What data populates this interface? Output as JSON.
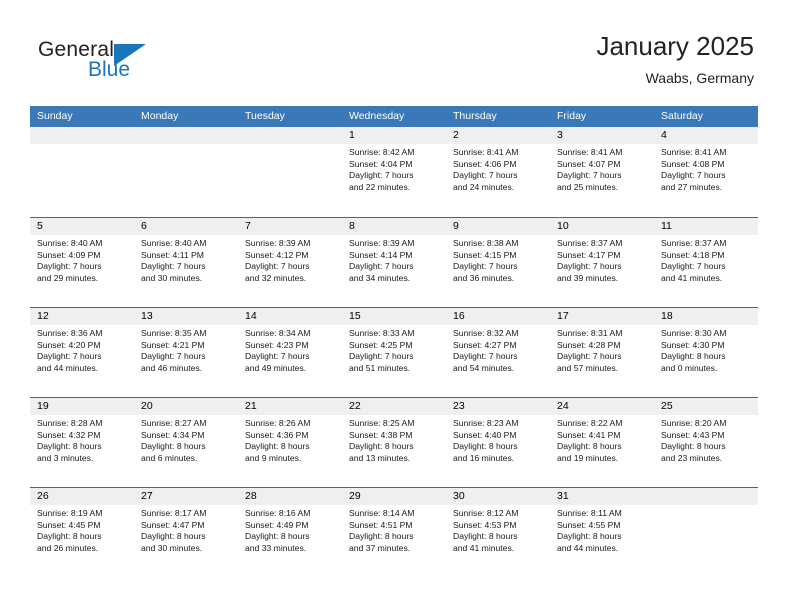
{
  "brand": {
    "name_part1": "General",
    "name_part2": "Blue",
    "flag_icon": "triangle-flag-icon",
    "accent_color": "#1b75bb"
  },
  "header": {
    "title": "January 2025",
    "subtitle": "Waabs, Germany"
  },
  "calendar": {
    "header_color": "#3b78b8",
    "weekdays": [
      "Sunday",
      "Monday",
      "Tuesday",
      "Wednesday",
      "Thursday",
      "Friday",
      "Saturday"
    ],
    "weeks": [
      [
        {
          "day": "",
          "lines": []
        },
        {
          "day": "",
          "lines": []
        },
        {
          "day": "",
          "lines": []
        },
        {
          "day": "1",
          "lines": [
            "Sunrise: 8:42 AM",
            "Sunset: 4:04 PM",
            "Daylight: 7 hours",
            "and 22 minutes."
          ]
        },
        {
          "day": "2",
          "lines": [
            "Sunrise: 8:41 AM",
            "Sunset: 4:06 PM",
            "Daylight: 7 hours",
            "and 24 minutes."
          ]
        },
        {
          "day": "3",
          "lines": [
            "Sunrise: 8:41 AM",
            "Sunset: 4:07 PM",
            "Daylight: 7 hours",
            "and 25 minutes."
          ]
        },
        {
          "day": "4",
          "lines": [
            "Sunrise: 8:41 AM",
            "Sunset: 4:08 PM",
            "Daylight: 7 hours",
            "and 27 minutes."
          ]
        }
      ],
      [
        {
          "day": "5",
          "lines": [
            "Sunrise: 8:40 AM",
            "Sunset: 4:09 PM",
            "Daylight: 7 hours",
            "and 29 minutes."
          ]
        },
        {
          "day": "6",
          "lines": [
            "Sunrise: 8:40 AM",
            "Sunset: 4:11 PM",
            "Daylight: 7 hours",
            "and 30 minutes."
          ]
        },
        {
          "day": "7",
          "lines": [
            "Sunrise: 8:39 AM",
            "Sunset: 4:12 PM",
            "Daylight: 7 hours",
            "and 32 minutes."
          ]
        },
        {
          "day": "8",
          "lines": [
            "Sunrise: 8:39 AM",
            "Sunset: 4:14 PM",
            "Daylight: 7 hours",
            "and 34 minutes."
          ]
        },
        {
          "day": "9",
          "lines": [
            "Sunrise: 8:38 AM",
            "Sunset: 4:15 PM",
            "Daylight: 7 hours",
            "and 36 minutes."
          ]
        },
        {
          "day": "10",
          "lines": [
            "Sunrise: 8:37 AM",
            "Sunset: 4:17 PM",
            "Daylight: 7 hours",
            "and 39 minutes."
          ]
        },
        {
          "day": "11",
          "lines": [
            "Sunrise: 8:37 AM",
            "Sunset: 4:18 PM",
            "Daylight: 7 hours",
            "and 41 minutes."
          ]
        }
      ],
      [
        {
          "day": "12",
          "lines": [
            "Sunrise: 8:36 AM",
            "Sunset: 4:20 PM",
            "Daylight: 7 hours",
            "and 44 minutes."
          ]
        },
        {
          "day": "13",
          "lines": [
            "Sunrise: 8:35 AM",
            "Sunset: 4:21 PM",
            "Daylight: 7 hours",
            "and 46 minutes."
          ]
        },
        {
          "day": "14",
          "lines": [
            "Sunrise: 8:34 AM",
            "Sunset: 4:23 PM",
            "Daylight: 7 hours",
            "and 49 minutes."
          ]
        },
        {
          "day": "15",
          "lines": [
            "Sunrise: 8:33 AM",
            "Sunset: 4:25 PM",
            "Daylight: 7 hours",
            "and 51 minutes."
          ]
        },
        {
          "day": "16",
          "lines": [
            "Sunrise: 8:32 AM",
            "Sunset: 4:27 PM",
            "Daylight: 7 hours",
            "and 54 minutes."
          ]
        },
        {
          "day": "17",
          "lines": [
            "Sunrise: 8:31 AM",
            "Sunset: 4:28 PM",
            "Daylight: 7 hours",
            "and 57 minutes."
          ]
        },
        {
          "day": "18",
          "lines": [
            "Sunrise: 8:30 AM",
            "Sunset: 4:30 PM",
            "Daylight: 8 hours",
            "and 0 minutes."
          ]
        }
      ],
      [
        {
          "day": "19",
          "lines": [
            "Sunrise: 8:28 AM",
            "Sunset: 4:32 PM",
            "Daylight: 8 hours",
            "and 3 minutes."
          ]
        },
        {
          "day": "20",
          "lines": [
            "Sunrise: 8:27 AM",
            "Sunset: 4:34 PM",
            "Daylight: 8 hours",
            "and 6 minutes."
          ]
        },
        {
          "day": "21",
          "lines": [
            "Sunrise: 8:26 AM",
            "Sunset: 4:36 PM",
            "Daylight: 8 hours",
            "and 9 minutes."
          ]
        },
        {
          "day": "22",
          "lines": [
            "Sunrise: 8:25 AM",
            "Sunset: 4:38 PM",
            "Daylight: 8 hours",
            "and 13 minutes."
          ]
        },
        {
          "day": "23",
          "lines": [
            "Sunrise: 8:23 AM",
            "Sunset: 4:40 PM",
            "Daylight: 8 hours",
            "and 16 minutes."
          ]
        },
        {
          "day": "24",
          "lines": [
            "Sunrise: 8:22 AM",
            "Sunset: 4:41 PM",
            "Daylight: 8 hours",
            "and 19 minutes."
          ]
        },
        {
          "day": "25",
          "lines": [
            "Sunrise: 8:20 AM",
            "Sunset: 4:43 PM",
            "Daylight: 8 hours",
            "and 23 minutes."
          ]
        }
      ],
      [
        {
          "day": "26",
          "lines": [
            "Sunrise: 8:19 AM",
            "Sunset: 4:45 PM",
            "Daylight: 8 hours",
            "and 26 minutes."
          ]
        },
        {
          "day": "27",
          "lines": [
            "Sunrise: 8:17 AM",
            "Sunset: 4:47 PM",
            "Daylight: 8 hours",
            "and 30 minutes."
          ]
        },
        {
          "day": "28",
          "lines": [
            "Sunrise: 8:16 AM",
            "Sunset: 4:49 PM",
            "Daylight: 8 hours",
            "and 33 minutes."
          ]
        },
        {
          "day": "29",
          "lines": [
            "Sunrise: 8:14 AM",
            "Sunset: 4:51 PM",
            "Daylight: 8 hours",
            "and 37 minutes."
          ]
        },
        {
          "day": "30",
          "lines": [
            "Sunrise: 8:12 AM",
            "Sunset: 4:53 PM",
            "Daylight: 8 hours",
            "and 41 minutes."
          ]
        },
        {
          "day": "31",
          "lines": [
            "Sunrise: 8:11 AM",
            "Sunset: 4:55 PM",
            "Daylight: 8 hours",
            "and 44 minutes."
          ]
        },
        {
          "day": "",
          "lines": []
        }
      ]
    ]
  }
}
